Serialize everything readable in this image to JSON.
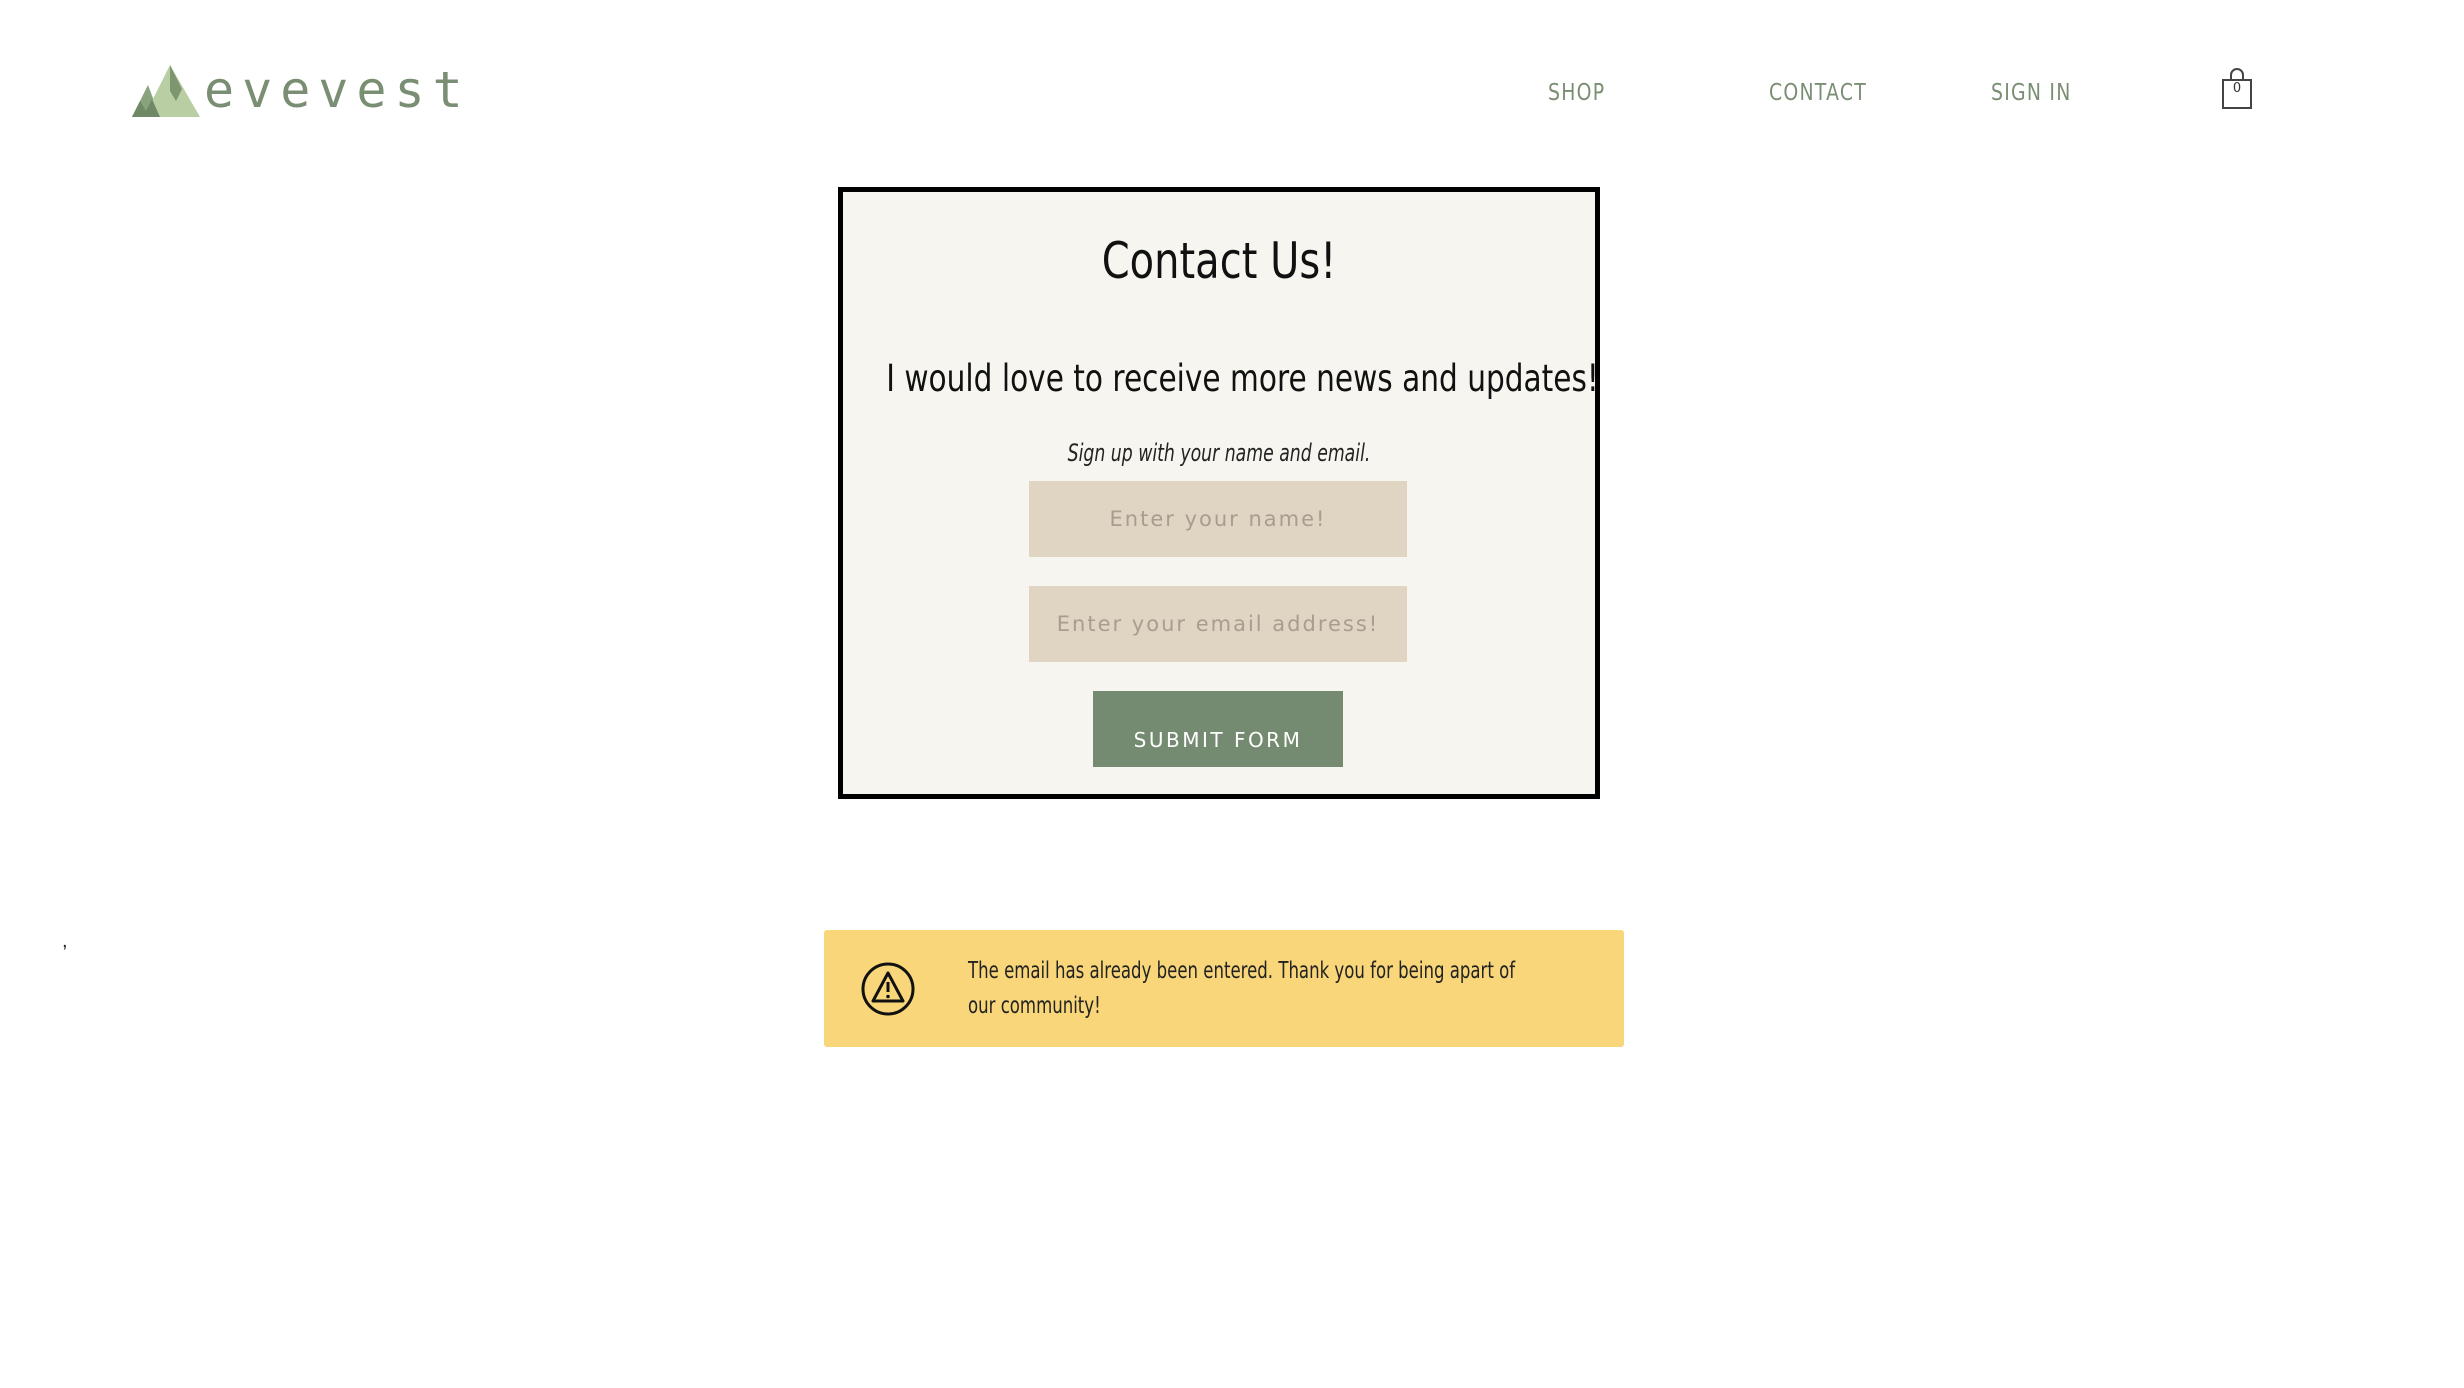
{
  "header": {
    "logo_text": "evevest",
    "logo_icon": "mountains-logo-icon",
    "nav": {
      "shop": "SHOP",
      "contact": "CONTACT",
      "sign_in": "SIGN IN"
    },
    "cart_icon": "shopping-bag-icon",
    "cart_count": "0"
  },
  "contact_form": {
    "title": "Contact Us!",
    "subtitle": "I would love to receive more news and updates!",
    "hint": "Sign up with your name and email.",
    "name_placeholder": "Enter your name!",
    "email_placeholder": "Enter your email address!",
    "submit_label": "SUBMIT FORM"
  },
  "alert": {
    "icon": "warning-icon",
    "message": "The email has already been entered. Thank you for being apart of our community!"
  },
  "stray_text": ",",
  "colors": {
    "brand_green": "#758b71",
    "input_bg": "#e0d4c3",
    "card_bg": "#f6f5ef",
    "alert_bg": "#f8d679"
  }
}
